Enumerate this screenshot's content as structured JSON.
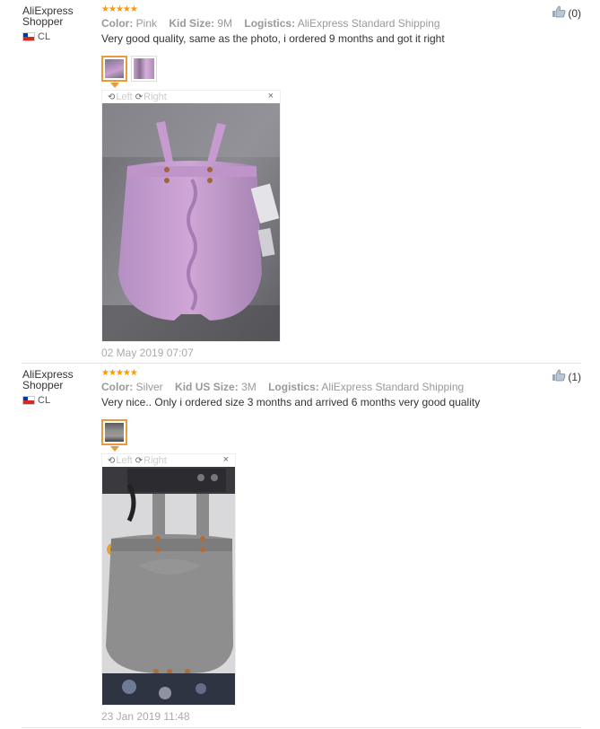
{
  "reviews": [
    {
      "user": {
        "name": "AliExpress Shopper",
        "country": "CL"
      },
      "rating": 5,
      "attributes": [
        {
          "label": "Color:",
          "value": "Pink"
        },
        {
          "label": "Kid Size:",
          "value": "9M"
        },
        {
          "label": "Logistics:",
          "value": "AliExpress Standard Shipping"
        }
      ],
      "text": "Very good quality, same as the photo, i ordered 9 months and got it right",
      "helpful_count": "(0)",
      "viewer": {
        "left_label": "Left",
        "right_label": "Right",
        "close": "×"
      },
      "date": "02 May 2019 07:07",
      "thumb_count": 2,
      "accent": "#c9a0d0"
    },
    {
      "user": {
        "name": "AliExpress Shopper",
        "country": "CL"
      },
      "rating": 5,
      "attributes": [
        {
          "label": "Color:",
          "value": "Silver"
        },
        {
          "label": "Kid US Size:",
          "value": "3M"
        },
        {
          "label": "Logistics:",
          "value": "AliExpress Standard Shipping"
        }
      ],
      "text": "Very nice.. Only i ordered size 3 months and arrived 6 months very good quality",
      "helpful_count": "(1)",
      "viewer": {
        "left_label": "Left",
        "right_label": "Right",
        "close": "×"
      },
      "date": "23 Jan 2019 11:48",
      "thumb_count": 1,
      "accent": "#8e8e8e"
    }
  ],
  "colors": {
    "star": "#ff9900",
    "active_border": "#e89a3c",
    "muted": "#999999"
  }
}
